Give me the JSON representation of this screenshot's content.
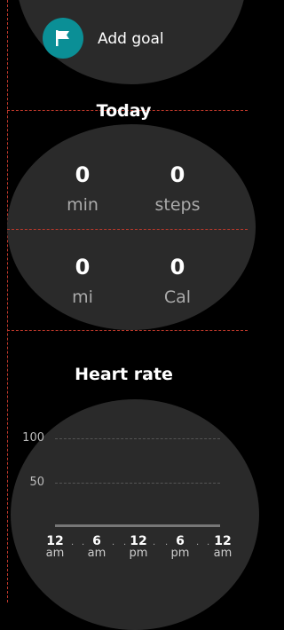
{
  "goal": {
    "label": "Add goal",
    "icon": "flag-icon",
    "accent": "#0b8f96"
  },
  "today": {
    "title": "Today",
    "stats": [
      {
        "value": "0",
        "unit": "min"
      },
      {
        "value": "0",
        "unit": "steps"
      },
      {
        "value": "0",
        "unit": "mi"
      },
      {
        "value": "0",
        "unit": "Cal"
      }
    ]
  },
  "heart_rate": {
    "title": "Heart rate",
    "y_ticks": [
      "100",
      "50"
    ],
    "x_ticks": [
      {
        "n": "12",
        "p": "am"
      },
      {
        "n": "6",
        "p": "am"
      },
      {
        "n": "12",
        "p": "pm"
      },
      {
        "n": "6",
        "p": "pm"
      },
      {
        "n": "12",
        "p": "am"
      }
    ]
  }
}
